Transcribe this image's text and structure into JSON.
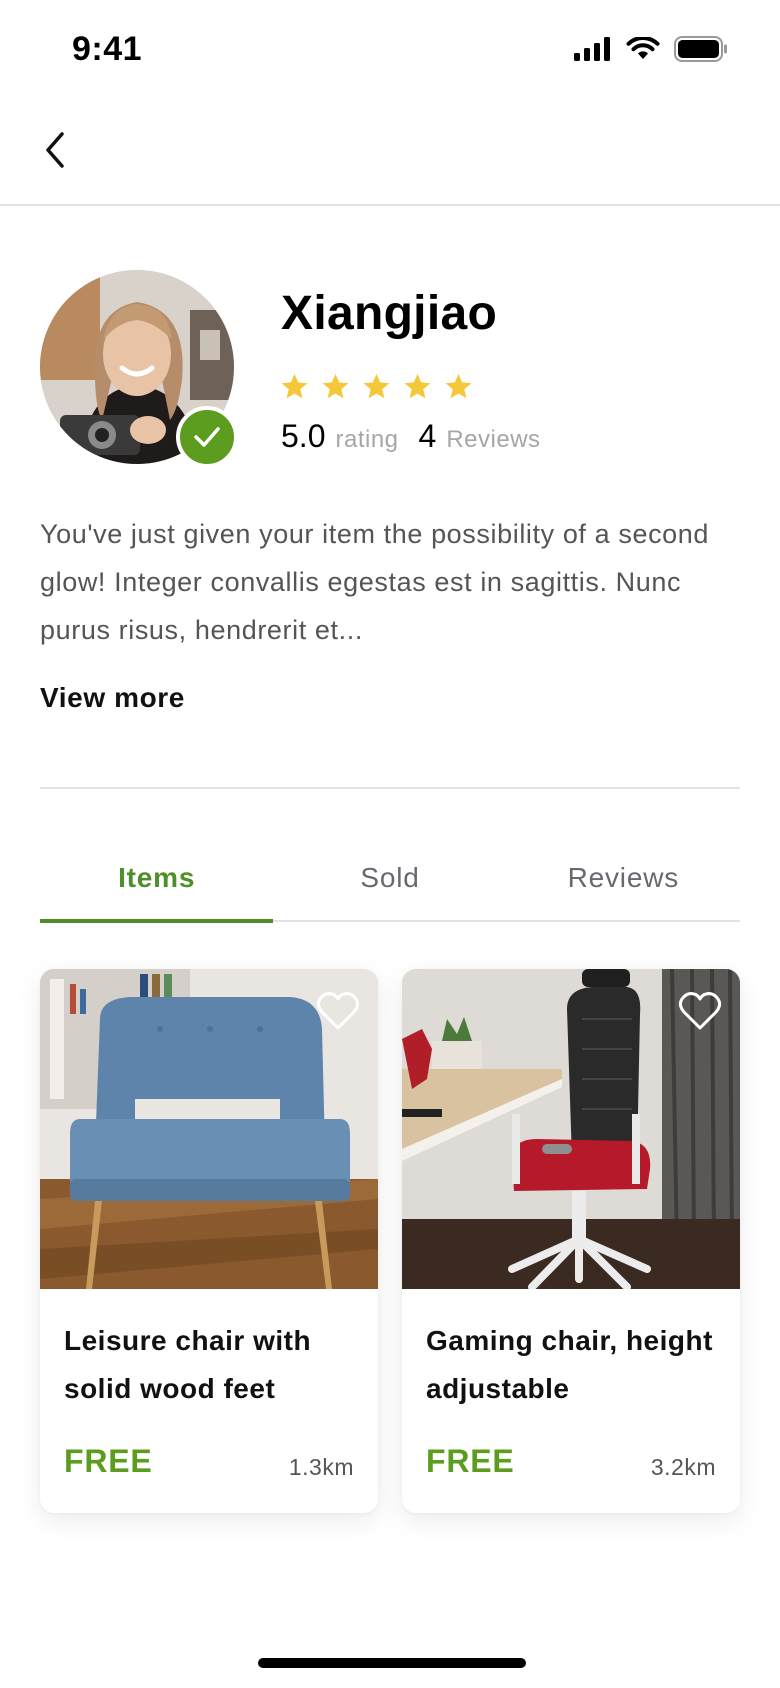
{
  "status_bar": {
    "time": "9:41",
    "icons": [
      "signal-icon",
      "wifi-icon",
      "battery-icon"
    ]
  },
  "nav": {
    "back_icon": "chevron-left-icon"
  },
  "profile": {
    "name": "Xiangjiao",
    "stars": 5,
    "rating_value": "5.0",
    "rating_label": "rating",
    "review_count": "4",
    "review_label": "Reviews",
    "verified": true,
    "bio": "You've just given your item the possibility of a second glow! Integer convallis egestas est in sagittis. Nunc purus risus, hendrerit et...",
    "view_more_label": "View more"
  },
  "tabs": [
    {
      "label": "Items",
      "active": true
    },
    {
      "label": "Sold",
      "active": false
    },
    {
      "label": "Reviews",
      "active": false
    }
  ],
  "items": [
    {
      "title": "Leisure chair with solid wood feet",
      "price": "FREE",
      "distance": "1.3km",
      "favorite": false
    },
    {
      "title": "Gaming chair, height adjustable",
      "price": "FREE",
      "distance": "3.2km",
      "favorite": false
    }
  ],
  "colors": {
    "accent_green": "#5c9c1f",
    "tab_active": "#4e8f2a",
    "star_yellow": "#f5c83a",
    "muted_text": "#a6a6a6"
  }
}
